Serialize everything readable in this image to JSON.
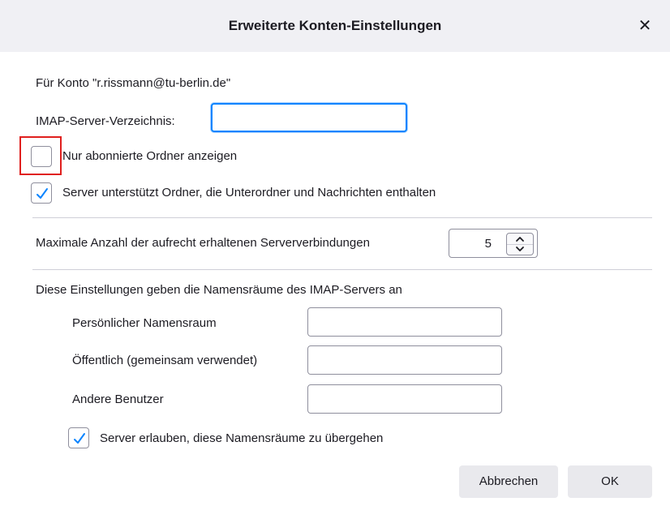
{
  "dialog": {
    "title": "Erweiterte Konten-Einstellungen",
    "close_icon": "close-icon",
    "close_glyph": "✕"
  },
  "account": {
    "label": "Für Konto \"r.rissmann@tu-berlin.de\""
  },
  "imap_dir": {
    "label": "IMAP-Server-Verzeichnis:",
    "value": "",
    "placeholder": ""
  },
  "checkboxes": {
    "subscribed_only": {
      "label": "Nur abonnierte Ordner anzeigen",
      "checked": false
    },
    "folders_with_subfolders": {
      "label": "Server unterstützt Ordner, die Unterordner und Nachrichten enthalten",
      "checked": true
    },
    "allow_override": {
      "label": "Server erlauben, diese Namensräume zu übergehen",
      "checked": true
    }
  },
  "connections": {
    "label": "Maximale Anzahl der aufrecht erhaltenen Serververbindungen",
    "value": "5"
  },
  "namespaces": {
    "heading": "Diese Einstellungen geben die Namensräume des IMAP-Servers an",
    "personal": {
      "label": "Persönlicher Namensraum",
      "value": ""
    },
    "public": {
      "label": "Öffentlich (gemeinsam verwendet)",
      "value": ""
    },
    "other_users": {
      "label": "Andere Benutzer",
      "value": ""
    }
  },
  "buttons": {
    "cancel": "Abbrechen",
    "ok": "OK"
  },
  "colors": {
    "accent": "#0a84ff",
    "highlight": "#e0201e",
    "titlebar": "#f0f0f4"
  }
}
